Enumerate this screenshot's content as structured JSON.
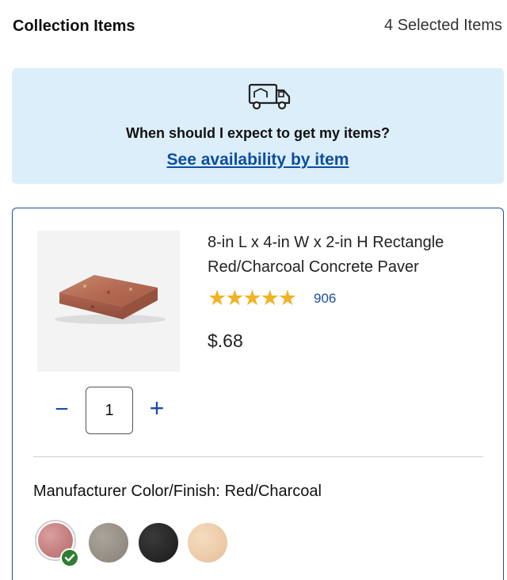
{
  "header": {
    "title": "Collection Items",
    "selected_count": "4 Selected Items"
  },
  "banner": {
    "icon": "delivery-truck-icon",
    "question": "When should I expect to get my items?",
    "link_text": "See availability by item"
  },
  "product": {
    "title": "8-in L x 4-in W x 2-in H Rectangle Red/Charcoal Concrete Paver",
    "stars": "★★★★★",
    "rating_value": 5,
    "review_count": "906",
    "price": "$.68",
    "quantity": "1",
    "quantity_minus": "−",
    "quantity_plus": "+",
    "color_label": "Manufacturer Color/Finish:",
    "color_value": "Red/Charcoal",
    "swatches": [
      {
        "name": "Red/Charcoal",
        "color": "#c98a8a",
        "selected": true
      },
      {
        "name": "Gray",
        "color": "#9a948a",
        "selected": false
      },
      {
        "name": "Charcoal",
        "color": "#2b2b2b",
        "selected": false
      },
      {
        "name": "Tan",
        "color": "#efd0b0",
        "selected": false
      }
    ]
  },
  "colors": {
    "accent": "#1c4fa3",
    "link": "#0c4ea2",
    "banner_bg": "#dceefa",
    "star": "#f2b224",
    "check": "#2e7d32"
  }
}
